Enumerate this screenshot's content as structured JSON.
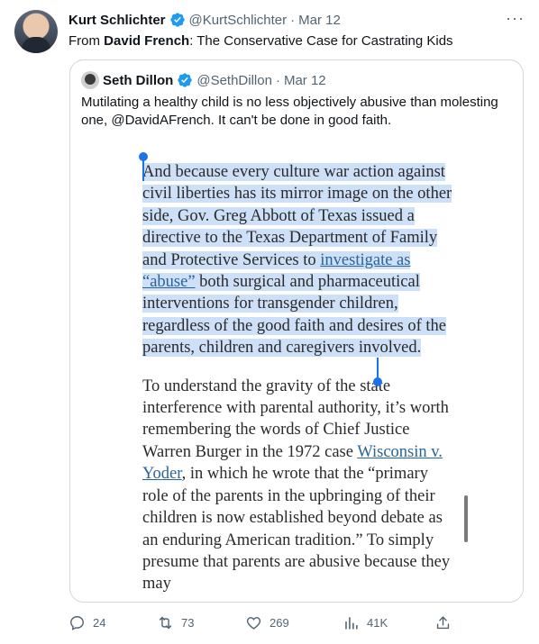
{
  "author": {
    "name": "Kurt Schlichter",
    "handle": "@KurtSchlichter",
    "separator": "·",
    "date": "Mar 12"
  },
  "tweet_text": {
    "prefix": "From ",
    "bold_name": "David French",
    "suffix": ": The Conservative Case for Castrating Kids"
  },
  "more_label": "···",
  "quoted": {
    "name": "Seth Dillon",
    "handle": "@SethDillon",
    "separator": "·",
    "date": "Mar 12",
    "text": "Mutilating a healthy child is no less objectively abusive than molesting one, @DavidAFrench. It can't be done in good faith."
  },
  "article": {
    "para1_a": "And because every culture war action against civil liberties has its mirror image on the other side, Gov. Greg Abbott of Texas issued a directive to the Texas Department of Family and Protective Services to ",
    "para1_link": "investigate as “abuse”",
    "para1_b": " both surgical and pharmaceutical interventions for transgender children, regardless of the good faith and desires of the parents, children and caregivers involved.",
    "para2_a": "To understand the gravity of the state interference with parental authority, it’s worth remembering the words of Chief Justice Warren Burger in the 1972 case ",
    "para2_link": "Wisconsin v. Yoder",
    "para2_b": ", in which he wrote that the “primary role of the parents in the upbringing of their children is now established beyond debate as an enduring American tradition.” To simply presume that parents are abusive because they may"
  },
  "actions": {
    "replies": "24",
    "retweets": "73",
    "likes": "269",
    "views": "41K"
  },
  "icons": [
    "verified-badge-icon",
    "more-icon",
    "reply-icon",
    "retweet-icon",
    "like-icon",
    "views-icon",
    "share-icon"
  ],
  "colors": {
    "verified": "#1d9bf0",
    "muted": "#536471",
    "selection": "#cde0f7",
    "handle": "#1a73e8"
  }
}
